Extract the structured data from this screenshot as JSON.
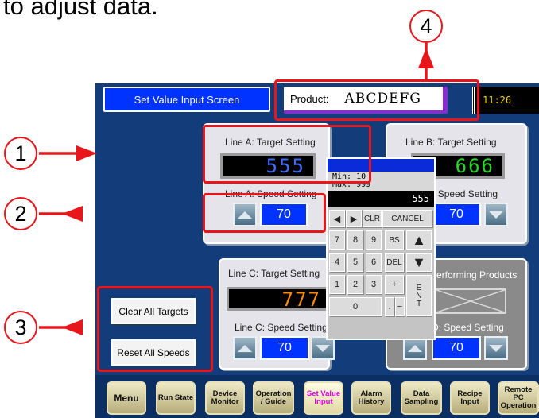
{
  "caption": "to adjust data.",
  "screen": {
    "title": "Set Value Input Screen",
    "product_label": "Product:",
    "product_value": "ABCDEFG",
    "clock": "11:26"
  },
  "panels": {
    "line_a": {
      "target_label": "Line A: Target Setting",
      "target_value": "555",
      "speed_label": "Line A: Speed Setting",
      "speed_value": "70"
    },
    "line_b": {
      "target_label": "Line B: Target Setting",
      "target_value": "666",
      "speed_label": "Line B: Speed Setting",
      "speed_value": "70"
    },
    "line_c": {
      "target_label": "Line C: Target Setting",
      "target_value": "777",
      "speed_label": "Line C: Speed Setting",
      "speed_value": "70"
    },
    "line_d": {
      "target_label": "Performing Products",
      "speed_label": "Line D: Speed Setting",
      "speed_value": "70"
    }
  },
  "side_buttons": {
    "clear_all_targets": "Clear All Targets",
    "reset_all_speeds": "Reset All Speeds"
  },
  "keypad": {
    "min": "Min:  10",
    "max": "Max: 999",
    "entry": "555",
    "keys": {
      "left": "◀",
      "right": "▶",
      "clr": "CLR",
      "cancel": "CANCEL",
      "k7": "7",
      "k8": "8",
      "k9": "9",
      "bs": "BS",
      "up": "▲",
      "k4": "4",
      "k5": "5",
      "k6": "6",
      "del": "DEL",
      "down": "▼",
      "k1": "1",
      "k2": "2",
      "k3": "3",
      "plus": "+",
      "ent": "ENT",
      "k0": "0",
      "dot": ".",
      "minus": "−"
    }
  },
  "nav": {
    "menu": "Menu",
    "run_state": "Run State",
    "device_monitor": "Device Monitor",
    "operation_guide": "Operation / Guide",
    "set_value_input": "Set Value Input",
    "alarm_history": "Alarm History",
    "data_sampling": "Data Sampling",
    "recipe_input": "Recipe Input",
    "remote_pc": "Remote PC Operation"
  },
  "callouts": {
    "c1": "1",
    "c2": "2",
    "c3": "3",
    "c4": "4"
  },
  "colors": {
    "highlight": "#e8161b",
    "screen_bg": "#123d7a",
    "accent_blue": "#0033ff",
    "active_nav_text": "#e000e0"
  }
}
